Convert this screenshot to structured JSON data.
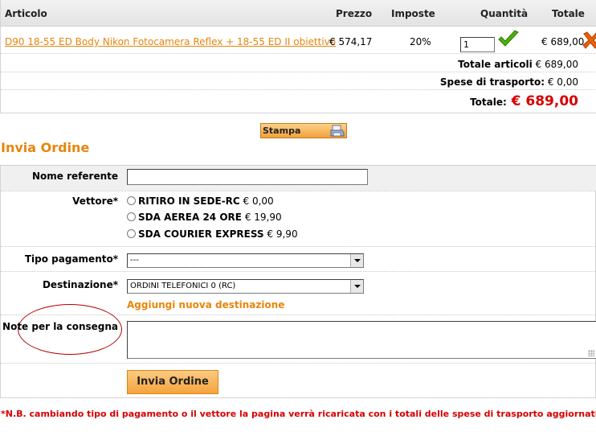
{
  "cart": {
    "headers": {
      "article": "Articolo",
      "price": "Prezzo",
      "taxes": "Imposte",
      "quantity": "Quantità",
      "total": "Totale"
    },
    "items": [
      {
        "name": "D90 18-55 ED Body Nikon Fotocamera Reflex + 18-55 ED II obiettivo",
        "price": "€ 574,17",
        "tax": "20%",
        "quantity": "1",
        "total": "€ 689,00"
      }
    ],
    "summary": {
      "articles_label": "Totale articoli",
      "articles_value": "€ 689,00",
      "shipping_label": "Spese di trasporto:",
      "shipping_value": "€ 0,00",
      "grand_label": "Totale:",
      "grand_value": "€ 689,00"
    }
  },
  "print_button": {
    "label": "Stampa"
  },
  "order_form": {
    "title": "Invia Ordine",
    "reference_label": "Nome referente",
    "reference_value": "",
    "carrier_label": "Vettore*",
    "carriers": [
      {
        "name": "RITIRO IN SEDE-RC",
        "price": "€ 0,00"
      },
      {
        "name": "SDA AEREA 24 ORE",
        "price": "€ 19,90"
      },
      {
        "name": "SDA COURIER EXPRESS",
        "price": "€ 9,90"
      }
    ],
    "payment_label": "Tipo pagamento*",
    "payment_value": "---",
    "destination_label": "Destinazione*",
    "destination_value": "ORDINI TELEFONICI 0 (RC)",
    "add_destination": "Aggiungi nuova destinazione",
    "notes_label": "Note per la consegna",
    "notes_value": "",
    "submit_label": "Invia Ordine"
  },
  "footnote": "*N.B. cambiando tipo di pagamento o il vettore la pagina verrà ricaricata con i totali delle spese di trasporto aggiornati",
  "colors": {
    "accent_orange": "#e8850c",
    "total_red": "#d60000",
    "ok_green": "#44a000",
    "delete_orange": "#e85a0c"
  },
  "icons": {
    "confirm": "checkmark-icon",
    "delete": "delete-x-icon",
    "print": "printer-icon"
  }
}
